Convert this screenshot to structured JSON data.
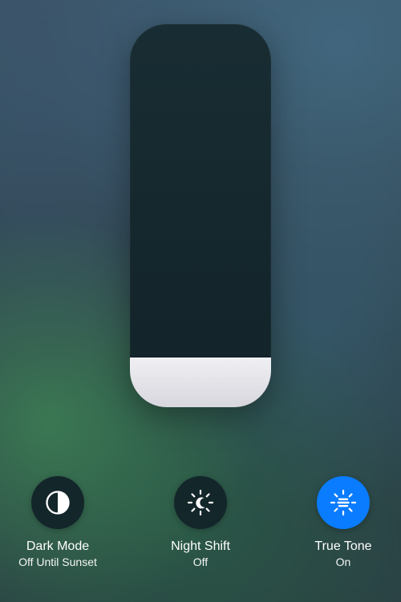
{
  "brightness": {
    "pct": 13
  },
  "toggles": {
    "dark_mode": {
      "title": "Dark Mode",
      "subtitle": "Off Until Sunset",
      "active": false
    },
    "night_shift": {
      "title": "Night Shift",
      "subtitle": "Off",
      "active": false
    },
    "true_tone": {
      "title": "True Tone",
      "subtitle": "On",
      "active": true
    }
  },
  "colors": {
    "active_bg": "#0a7cff",
    "inactive_bg": "#13262a"
  }
}
